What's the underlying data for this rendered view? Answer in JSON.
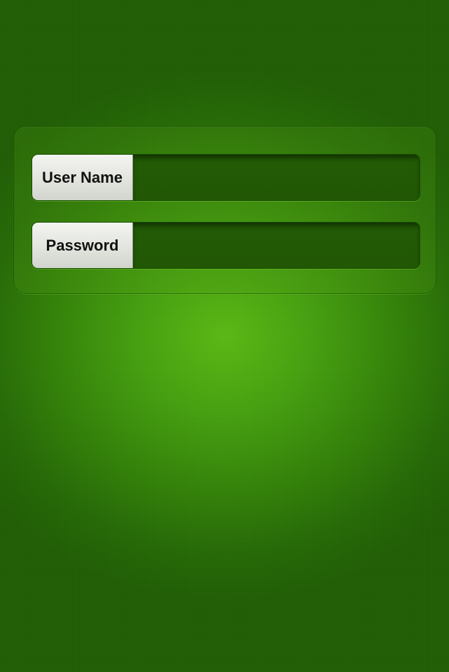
{
  "login_form": {
    "username": {
      "label": "User Name",
      "value": ""
    },
    "password": {
      "label": "Password",
      "value": ""
    }
  },
  "colors": {
    "background_center": "#5bb814",
    "background_edge": "#215e05",
    "input_fill": "#225805",
    "label_fill": "#e2e4de"
  }
}
